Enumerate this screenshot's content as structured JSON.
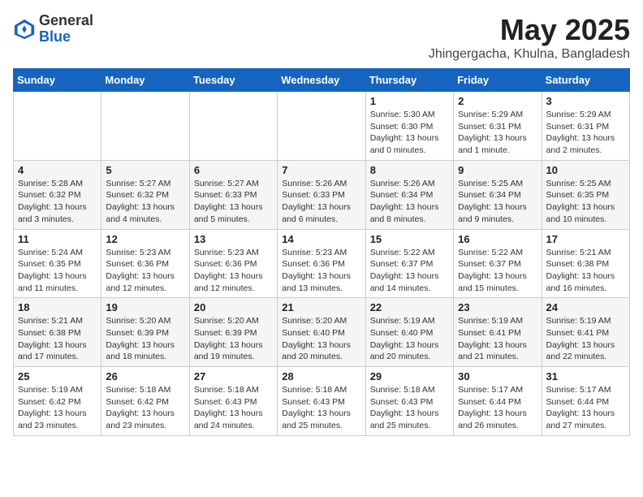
{
  "logo": {
    "general": "General",
    "blue": "Blue"
  },
  "title": {
    "month": "May 2025",
    "location": "Jhingergacha, Khulna, Bangladesh"
  },
  "days_of_week": [
    "Sunday",
    "Monday",
    "Tuesday",
    "Wednesday",
    "Thursday",
    "Friday",
    "Saturday"
  ],
  "weeks": [
    [
      {
        "day": "",
        "info": ""
      },
      {
        "day": "",
        "info": ""
      },
      {
        "day": "",
        "info": ""
      },
      {
        "day": "",
        "info": ""
      },
      {
        "day": "1",
        "info": "Sunrise: 5:30 AM\nSunset: 6:30 PM\nDaylight: 13 hours\nand 0 minutes."
      },
      {
        "day": "2",
        "info": "Sunrise: 5:29 AM\nSunset: 6:31 PM\nDaylight: 13 hours\nand 1 minute."
      },
      {
        "day": "3",
        "info": "Sunrise: 5:29 AM\nSunset: 6:31 PM\nDaylight: 13 hours\nand 2 minutes."
      }
    ],
    [
      {
        "day": "4",
        "info": "Sunrise: 5:28 AM\nSunset: 6:32 PM\nDaylight: 13 hours\nand 3 minutes."
      },
      {
        "day": "5",
        "info": "Sunrise: 5:27 AM\nSunset: 6:32 PM\nDaylight: 13 hours\nand 4 minutes."
      },
      {
        "day": "6",
        "info": "Sunrise: 5:27 AM\nSunset: 6:33 PM\nDaylight: 13 hours\nand 5 minutes."
      },
      {
        "day": "7",
        "info": "Sunrise: 5:26 AM\nSunset: 6:33 PM\nDaylight: 13 hours\nand 6 minutes."
      },
      {
        "day": "8",
        "info": "Sunrise: 5:26 AM\nSunset: 6:34 PM\nDaylight: 13 hours\nand 8 minutes."
      },
      {
        "day": "9",
        "info": "Sunrise: 5:25 AM\nSunset: 6:34 PM\nDaylight: 13 hours\nand 9 minutes."
      },
      {
        "day": "10",
        "info": "Sunrise: 5:25 AM\nSunset: 6:35 PM\nDaylight: 13 hours\nand 10 minutes."
      }
    ],
    [
      {
        "day": "11",
        "info": "Sunrise: 5:24 AM\nSunset: 6:35 PM\nDaylight: 13 hours\nand 11 minutes."
      },
      {
        "day": "12",
        "info": "Sunrise: 5:23 AM\nSunset: 6:36 PM\nDaylight: 13 hours\nand 12 minutes."
      },
      {
        "day": "13",
        "info": "Sunrise: 5:23 AM\nSunset: 6:36 PM\nDaylight: 13 hours\nand 12 minutes."
      },
      {
        "day": "14",
        "info": "Sunrise: 5:23 AM\nSunset: 6:36 PM\nDaylight: 13 hours\nand 13 minutes."
      },
      {
        "day": "15",
        "info": "Sunrise: 5:22 AM\nSunset: 6:37 PM\nDaylight: 13 hours\nand 14 minutes."
      },
      {
        "day": "16",
        "info": "Sunrise: 5:22 AM\nSunset: 6:37 PM\nDaylight: 13 hours\nand 15 minutes."
      },
      {
        "day": "17",
        "info": "Sunrise: 5:21 AM\nSunset: 6:38 PM\nDaylight: 13 hours\nand 16 minutes."
      }
    ],
    [
      {
        "day": "18",
        "info": "Sunrise: 5:21 AM\nSunset: 6:38 PM\nDaylight: 13 hours\nand 17 minutes."
      },
      {
        "day": "19",
        "info": "Sunrise: 5:20 AM\nSunset: 6:39 PM\nDaylight: 13 hours\nand 18 minutes."
      },
      {
        "day": "20",
        "info": "Sunrise: 5:20 AM\nSunset: 6:39 PM\nDaylight: 13 hours\nand 19 minutes."
      },
      {
        "day": "21",
        "info": "Sunrise: 5:20 AM\nSunset: 6:40 PM\nDaylight: 13 hours\nand 20 minutes."
      },
      {
        "day": "22",
        "info": "Sunrise: 5:19 AM\nSunset: 6:40 PM\nDaylight: 13 hours\nand 20 minutes."
      },
      {
        "day": "23",
        "info": "Sunrise: 5:19 AM\nSunset: 6:41 PM\nDaylight: 13 hours\nand 21 minutes."
      },
      {
        "day": "24",
        "info": "Sunrise: 5:19 AM\nSunset: 6:41 PM\nDaylight: 13 hours\nand 22 minutes."
      }
    ],
    [
      {
        "day": "25",
        "info": "Sunrise: 5:19 AM\nSunset: 6:42 PM\nDaylight: 13 hours\nand 23 minutes."
      },
      {
        "day": "26",
        "info": "Sunrise: 5:18 AM\nSunset: 6:42 PM\nDaylight: 13 hours\nand 23 minutes."
      },
      {
        "day": "27",
        "info": "Sunrise: 5:18 AM\nSunset: 6:43 PM\nDaylight: 13 hours\nand 24 minutes."
      },
      {
        "day": "28",
        "info": "Sunrise: 5:18 AM\nSunset: 6:43 PM\nDaylight: 13 hours\nand 25 minutes."
      },
      {
        "day": "29",
        "info": "Sunrise: 5:18 AM\nSunset: 6:43 PM\nDaylight: 13 hours\nand 25 minutes."
      },
      {
        "day": "30",
        "info": "Sunrise: 5:17 AM\nSunset: 6:44 PM\nDaylight: 13 hours\nand 26 minutes."
      },
      {
        "day": "31",
        "info": "Sunrise: 5:17 AM\nSunset: 6:44 PM\nDaylight: 13 hours\nand 27 minutes."
      }
    ]
  ]
}
